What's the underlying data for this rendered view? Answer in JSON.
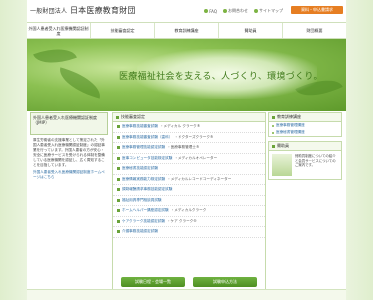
{
  "header": {
    "logo_small": "一般財団法人",
    "logo_main": "日本医療教育財団",
    "toplinks": [
      "FAQ",
      "お問合わせ",
      "サイトマップ"
    ],
    "apply_button": "資料・申込書請求"
  },
  "nav": [
    "外国人患者受入れ医療機関認証制度",
    "技能審査認定",
    "教育訓練講座",
    "賛助員",
    "財団概要"
  ],
  "hero": {
    "tagline": "医療福祉社会を支える、人づくり、環境づくり。"
  },
  "left": {
    "title": "外国人患者受入れ医療機関認証制度（JMIP）",
    "body": "厚生労働省の支援事業として策定された「外国人患者受入れ医療機関認証制度」の認証事業を行っています。外国人患者の方が安心・安全に医療サービスを受けられる体制を整備している医療機関を認証し、広く周知することを目指しています。",
    "link": "外国人患者受入れ医療機関認証制度ホームページはこちら"
  },
  "center": {
    "title": "技能審査認定",
    "items": [
      {
        "name": "医療事務技能審査試験",
        "tag": "・メディカル クラーク®"
      },
      {
        "name": "医療事務技能審査試験（歯科）",
        "tag": "・ドクターズクラーク®"
      },
      {
        "name": "医療事務管理技能認定試験",
        "tag": "・医療事務管理士®"
      },
      {
        "name": "医事コンピュータ技能検定試験",
        "tag": "・メディカルオペレーター"
      },
      {
        "name": "医療秘書技能認定試験",
        "tag": ""
      },
      {
        "name": "医療情報実務能力検定試験",
        "tag": "・メディカルレコードコーディネーター"
      },
      {
        "name": "調剤報酬請求事務技能認定試験",
        "tag": ""
      },
      {
        "name": "福祉用具専門相談員試験",
        "tag": ""
      },
      {
        "name": "ホームヘルパー講座認定試験",
        "tag": "・メディカルクラーク"
      },
      {
        "name": "ケアクラーク技能認定試験",
        "tag": "・ケア クラーク®"
      },
      {
        "name": "介護事務技能認定試験",
        "tag": ""
      }
    ],
    "btn_schedule": "試験日程・会場一覧",
    "btn_apply": "試験申込方法"
  },
  "right": {
    "box1_title": "教育訓練講座",
    "box1_links": [
      "医療事務管理講座",
      "医療秘書管理講座"
    ],
    "box2_title": "賛助員",
    "box2_text": "賛助員制度についての紹介と会員サービスについてのご案内です。"
  },
  "colors": {
    "accent": "#6aa33a",
    "button_orange": "#e67e22",
    "link": "#2e6da4"
  }
}
